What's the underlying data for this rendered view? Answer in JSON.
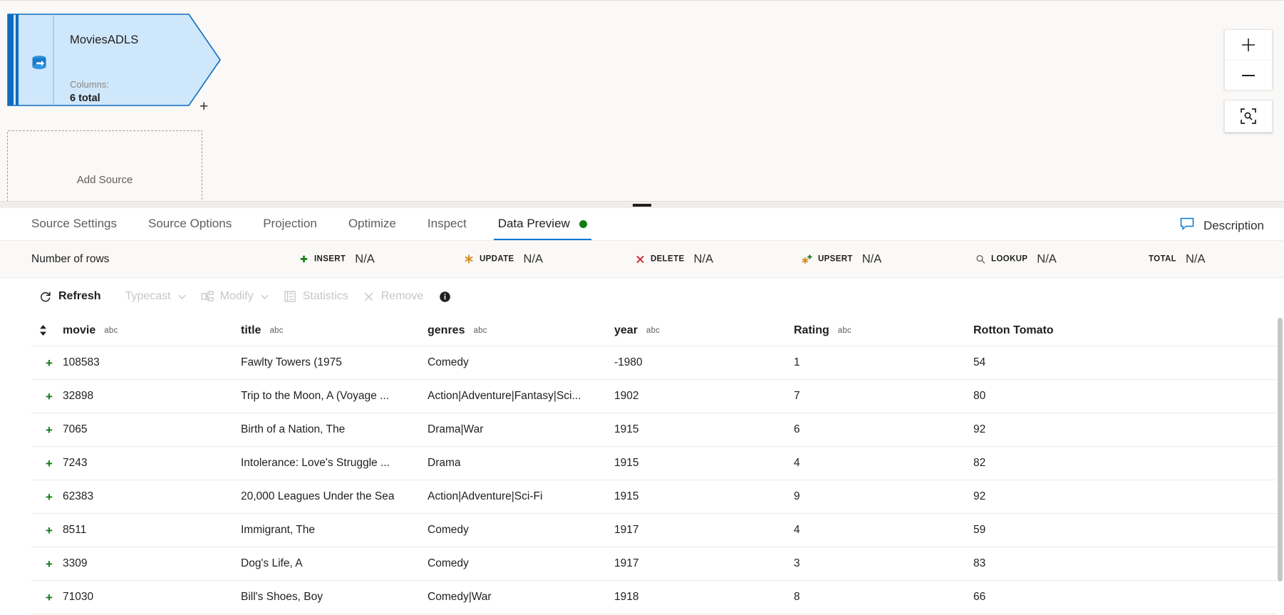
{
  "canvas": {
    "node": {
      "title": "MoviesADLS",
      "columns_label": "Columns:",
      "columns_value": "6 total",
      "add_connector": "+",
      "icon": "source-database-icon"
    },
    "add_source": {
      "label": "Add Source"
    },
    "zoom_controls": {
      "zoom_in": "+",
      "zoom_out": "−",
      "fit_to_screen": "fit-to-screen-icon"
    }
  },
  "panel": {
    "tabs": [
      {
        "label": "Source Settings",
        "active": false
      },
      {
        "label": "Source Options",
        "active": false
      },
      {
        "label": "Projection",
        "active": false
      },
      {
        "label": "Optimize",
        "active": false
      },
      {
        "label": "Inspect",
        "active": false
      },
      {
        "label": "Data Preview",
        "active": true,
        "status_dot": "#107c10"
      }
    ],
    "description_button": {
      "label": "Description",
      "icon": "comment-icon"
    },
    "stats": {
      "title": "Number of rows",
      "items": [
        {
          "label": "INSERT",
          "value": "N/A",
          "icon": "plus-icon",
          "color": "#107c10"
        },
        {
          "label": "UPDATE",
          "value": "N/A",
          "icon": "asterisk-icon",
          "color": "#d38b19"
        },
        {
          "label": "DELETE",
          "value": "N/A",
          "icon": "cross-icon",
          "color": "#d13438"
        },
        {
          "label": "UPSERT",
          "value": "N/A",
          "icon": "upsert-icon",
          "color": "#d38b19"
        },
        {
          "label": "LOOKUP",
          "value": "N/A",
          "icon": "search-icon",
          "color": "#605e5c"
        },
        {
          "label": "TOTAL",
          "value": "N/A",
          "icon": "none",
          "color": "#201f1e"
        }
      ]
    },
    "toolbar": {
      "refresh": {
        "label": "Refresh",
        "enabled": true,
        "icon": "refresh-icon"
      },
      "typecast": {
        "label": "Typecast",
        "enabled": false,
        "icon": "chevron-down-icon"
      },
      "modify": {
        "label": "Modify",
        "enabled": false,
        "icon": "modify-icon"
      },
      "statistics": {
        "label": "Statistics",
        "enabled": false,
        "icon": "statistics-icon"
      },
      "remove": {
        "label": "Remove",
        "enabled": false,
        "icon": "close-icon"
      },
      "info": {
        "icon": "info-icon"
      }
    },
    "grid": {
      "columns": [
        {
          "name": "movie",
          "type": "abc"
        },
        {
          "name": "title",
          "type": "abc"
        },
        {
          "name": "genres",
          "type": "abc"
        },
        {
          "name": "year",
          "type": "abc"
        },
        {
          "name": "Rating",
          "type": "abc"
        },
        {
          "name": "Rotton Tomato",
          "type": "abc"
        }
      ],
      "rows": [
        {
          "movie": "108583",
          "title": "Fawlty Towers (1975",
          "genres": "Comedy",
          "year": "-1980",
          "rating": "1",
          "tomato": "54"
        },
        {
          "movie": "32898",
          "title": "Trip to the Moon, A (Voyage ...",
          "genres": "Action|Adventure|Fantasy|Sci...",
          "year": "1902",
          "rating": "7",
          "tomato": "80"
        },
        {
          "movie": "7065",
          "title": "Birth of a Nation, The",
          "genres": "Drama|War",
          "year": "1915",
          "rating": "6",
          "tomato": "92"
        },
        {
          "movie": "7243",
          "title": "Intolerance: Love's Struggle ...",
          "genres": "Drama",
          "year": "1915",
          "rating": "4",
          "tomato": "82"
        },
        {
          "movie": "62383",
          "title": "20,000 Leagues Under the Sea",
          "genres": "Action|Adventure|Sci-Fi",
          "year": "1915",
          "rating": "9",
          "tomato": "92"
        },
        {
          "movie": "8511",
          "title": "Immigrant, The",
          "genres": "Comedy",
          "year": "1917",
          "rating": "4",
          "tomato": "59"
        },
        {
          "movie": "3309",
          "title": "Dog's Life, A",
          "genres": "Comedy",
          "year": "1917",
          "rating": "3",
          "tomato": "83"
        },
        {
          "movie": "71030",
          "title": "Bill's Shoes, Boy",
          "genres": "Comedy|War",
          "year": "1918",
          "rating": "8",
          "tomato": "66"
        }
      ],
      "row_add_symbol": "+"
    }
  },
  "colors": {
    "accent": "#0078d4",
    "node_fill": "#cfe7fa",
    "node_border": "#0f6cbd",
    "success": "#107c10",
    "warning": "#d38b19",
    "danger": "#d13438",
    "panel_bg": "#ffffff",
    "canvas_bg": "#faf9f8"
  }
}
